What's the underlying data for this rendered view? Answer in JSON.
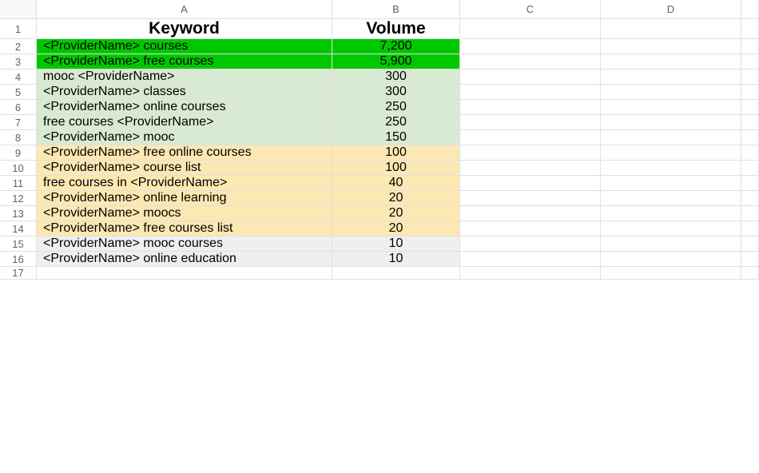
{
  "columns": [
    "A",
    "B",
    "C",
    "D",
    ""
  ],
  "headers": {
    "keyword": "Keyword",
    "volume": "Volume"
  },
  "row_numbers": [
    1,
    2,
    3,
    4,
    5,
    6,
    7,
    8,
    9,
    10,
    11,
    12,
    13,
    14,
    15,
    16,
    17
  ],
  "rows": [
    {
      "keyword": "<ProviderName> courses",
      "volume": "7,200",
      "tier": "bright"
    },
    {
      "keyword": "<ProviderName> free courses",
      "volume": "5,900",
      "tier": "bright"
    },
    {
      "keyword": "mooc <ProviderName>",
      "volume": "300",
      "tier": "light"
    },
    {
      "keyword": "<ProviderName> classes",
      "volume": "300",
      "tier": "light"
    },
    {
      "keyword": "<ProviderName> online courses",
      "volume": "250",
      "tier": "light"
    },
    {
      "keyword": "free courses <ProviderName>",
      "volume": "250",
      "tier": "light"
    },
    {
      "keyword": "<ProviderName> mooc",
      "volume": "150",
      "tier": "light"
    },
    {
      "keyword": "<ProviderName> free online courses",
      "volume": "100",
      "tier": "yellow"
    },
    {
      "keyword": "<ProviderName> course list",
      "volume": "100",
      "tier": "yellow"
    },
    {
      "keyword": "free courses in <ProviderName>",
      "volume": "40",
      "tier": "yellow"
    },
    {
      "keyword": "<ProviderName> online learning",
      "volume": "20",
      "tier": "yellow"
    },
    {
      "keyword": "<ProviderName> moocs",
      "volume": "20",
      "tier": "yellow"
    },
    {
      "keyword": "<ProviderName> free courses list",
      "volume": "20",
      "tier": "yellow"
    },
    {
      "keyword": "<ProviderName> mooc courses",
      "volume": "10",
      "tier": "gray"
    },
    {
      "keyword": "<ProviderName> online education",
      "volume": "10",
      "tier": "gray"
    }
  ],
  "chart_data": {
    "type": "table",
    "columns": [
      "Keyword",
      "Volume"
    ],
    "data": [
      [
        "<ProviderName> courses",
        7200
      ],
      [
        "<ProviderName> free courses",
        5900
      ],
      [
        "mooc <ProviderName>",
        300
      ],
      [
        "<ProviderName> classes",
        300
      ],
      [
        "<ProviderName> online courses",
        250
      ],
      [
        "free courses <ProviderName>",
        250
      ],
      [
        "<ProviderName> mooc",
        150
      ],
      [
        "<ProviderName> free online courses",
        100
      ],
      [
        "<ProviderName> course list",
        100
      ],
      [
        "free courses in <ProviderName>",
        40
      ],
      [
        "<ProviderName> online learning",
        20
      ],
      [
        "<ProviderName> moocs",
        20
      ],
      [
        "<ProviderName> free courses list",
        20
      ],
      [
        "<ProviderName> mooc courses",
        10
      ],
      [
        "<ProviderName> online education",
        10
      ]
    ]
  }
}
